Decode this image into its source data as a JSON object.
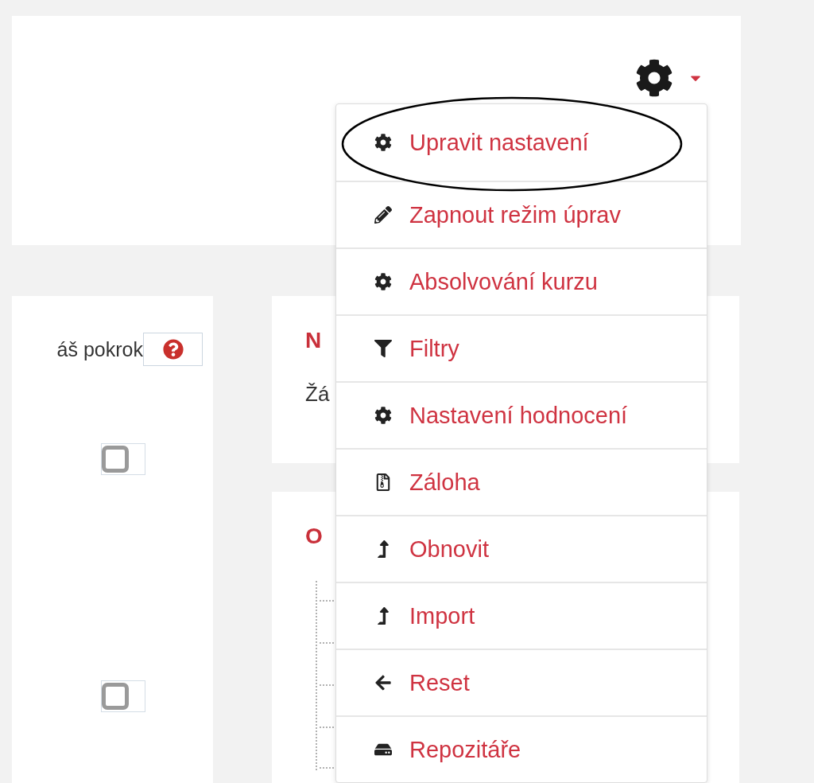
{
  "settings_menu": {
    "items": [
      {
        "label": "Upravit nastavení",
        "kind": "gear",
        "highlighted": true
      },
      {
        "label": "Zapnout režim úprav",
        "kind": "pencil",
        "highlighted": false
      },
      {
        "label": "Absolvování kurzu",
        "kind": "gear",
        "highlighted": false
      },
      {
        "label": "Filtry",
        "kind": "filter",
        "highlighted": false
      },
      {
        "label": "Nastavení hodnocení",
        "kind": "gear",
        "highlighted": false
      },
      {
        "label": "Záloha",
        "kind": "file",
        "highlighted": false
      },
      {
        "label": "Obnovit",
        "kind": "up",
        "highlighted": false
      },
      {
        "label": "Import",
        "kind": "up",
        "highlighted": false
      },
      {
        "label": "Reset",
        "kind": "left",
        "highlighted": false
      },
      {
        "label": "Repozitáře",
        "kind": "drive",
        "highlighted": false
      }
    ]
  },
  "progress_block": {
    "label": "áš pokrok",
    "checkboxes": [
      {
        "checked": false
      },
      {
        "checked": false
      }
    ]
  },
  "news_block": {
    "title": "N",
    "text": "Žá"
  },
  "second_block": {
    "title": "O"
  }
}
